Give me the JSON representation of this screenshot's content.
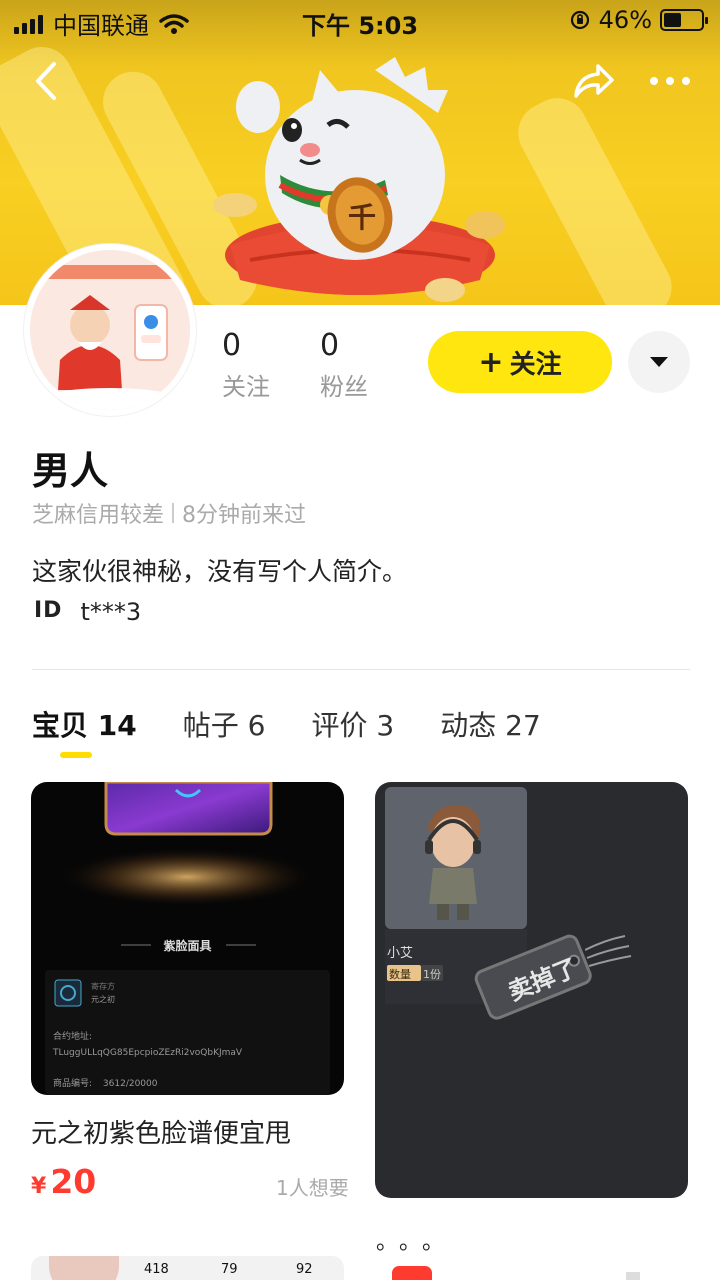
{
  "status_bar": {
    "carrier": "中国联通",
    "time": "下午 5:03",
    "battery": "46%",
    "battery_level": 0.46
  },
  "nav": {
    "back_icon": "chevron-left-icon",
    "share_icon": "share-icon",
    "more_icon": "more-icon"
  },
  "profile": {
    "following_count": "0",
    "following_label": "关注",
    "fans_count": "0",
    "fans_label": "粉丝",
    "follow_button": "关注",
    "name": "男人",
    "credit": "芝麻信用较差",
    "last_seen": "8分钟前来过",
    "bio": "这家伙很神秘，没有写个人简介。",
    "id_label": "ID",
    "id_value": "t***3"
  },
  "tabs": [
    {
      "label": "宝贝",
      "count": "14",
      "active": true
    },
    {
      "label": "帖子",
      "count": "6",
      "active": false
    },
    {
      "label": "评价",
      "count": "3",
      "active": false
    },
    {
      "label": "动态",
      "count": "27",
      "active": false
    }
  ],
  "items": [
    {
      "title": "元之初紫色脸谱便宜甩",
      "currency": "¥",
      "price": "20",
      "wants": "1人想要",
      "image_caption": "紫脸面具",
      "image_owner_label": "寄存方",
      "image_owner": "元之初",
      "image_address_label": "合约地址:",
      "image_address": "TLuggULLqQG85EpcpioZEzRi2voQbKJmaV",
      "image_number_label": "商品编号:",
      "image_number": "3612/20000"
    },
    {
      "image_name": "小艾",
      "image_qty_label": "数量",
      "image_qty": "1份",
      "sold_tag": "卖掉了"
    }
  ],
  "peek_numbers": [
    "418",
    "79",
    "92"
  ],
  "colors": {
    "accent_yellow": "#ffe60f",
    "price_red": "#ff3b30",
    "muted_gray": "#aaaaaa"
  }
}
